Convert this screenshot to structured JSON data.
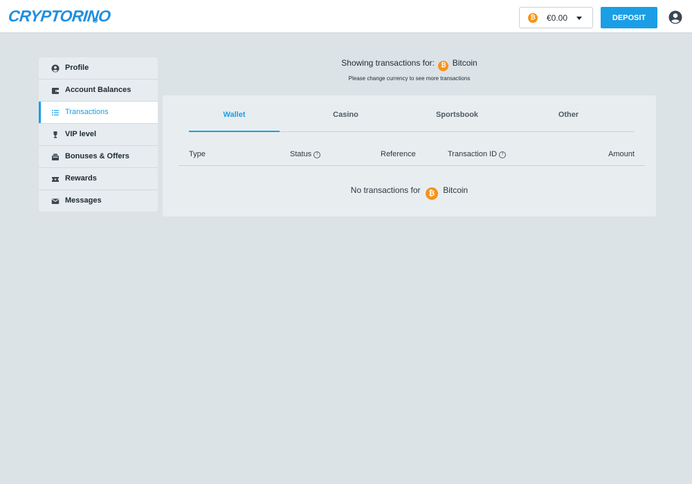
{
  "header": {
    "logo": "CRYPTORINO",
    "balance": "€0.00",
    "currency_symbol": "₿",
    "deposit_label": "DEPOSIT"
  },
  "sidebar": {
    "items": [
      {
        "label": "Profile",
        "icon": "profile-icon"
      },
      {
        "label": "Account Balances",
        "icon": "wallet-icon"
      },
      {
        "label": "Transactions",
        "icon": "list-icon",
        "active": true
      },
      {
        "label": "VIP level",
        "icon": "trophy-icon"
      },
      {
        "label": "Bonuses & Offers",
        "icon": "gift-icon"
      },
      {
        "label": "Rewards",
        "icon": "ticket-icon"
      },
      {
        "label": "Messages",
        "icon": "envelope-icon"
      }
    ]
  },
  "main": {
    "showing_prefix": "Showing transactions for:",
    "currency_name": "Bitcoin",
    "currency_symbol": "₿",
    "subtext": "Please change currency to see more transactions",
    "tabs": [
      {
        "label": "Wallet",
        "active": true
      },
      {
        "label": "Casino"
      },
      {
        "label": "Sportsbook"
      },
      {
        "label": "Other"
      }
    ],
    "columns": [
      "Type",
      "Status",
      "Reference",
      "Transaction ID",
      "Amount"
    ],
    "help_glyph": "?",
    "empty_prefix": "No transactions for",
    "empty_currency": "Bitcoin"
  },
  "colors": {
    "accent": "#1a9ee6",
    "bitcoin": "#f7931a",
    "background": "#dbe3e7",
    "panel": "#e8eef0"
  }
}
